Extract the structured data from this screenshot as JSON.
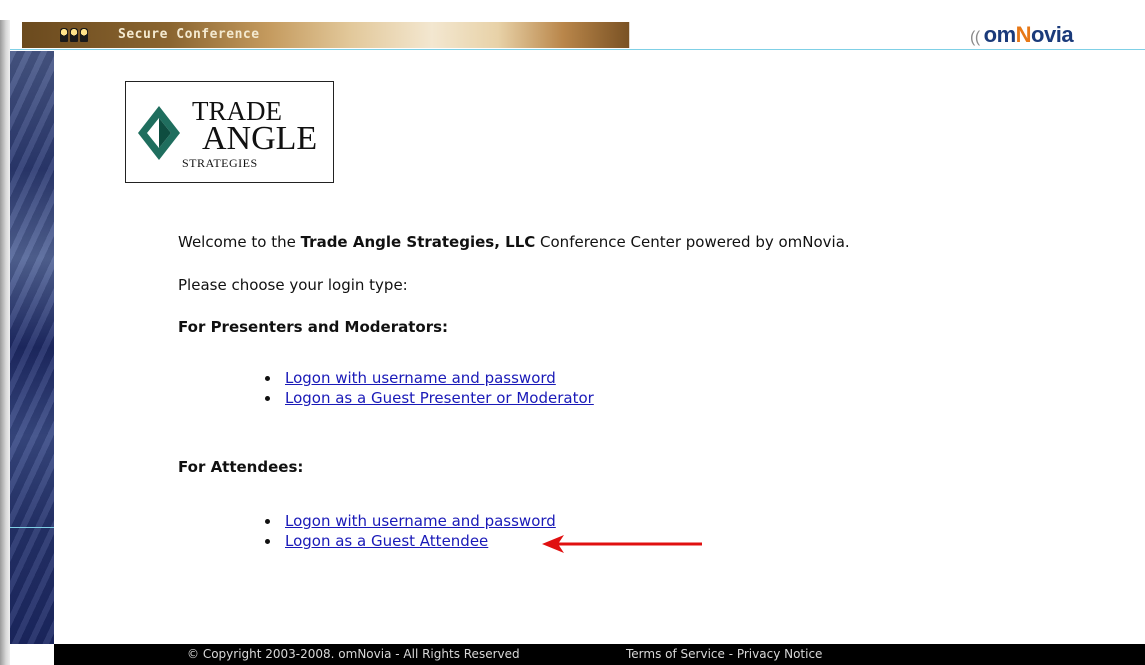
{
  "header": {
    "title": "Secure Conference",
    "brand": "omNovia",
    "brand_prefix": "om",
    "brand_n": "N",
    "brand_suffix": "ovia"
  },
  "logo": {
    "line1": "TRADE",
    "line2": "ANGLE",
    "line3": "STRATEGIES"
  },
  "welcome": {
    "prefix": "Welcome to the ",
    "company": "Trade Angle Strategies, LLC",
    "suffix": " Conference Center powered by omNovia."
  },
  "choose_text": "Please choose your login type:",
  "presenters": {
    "heading": "For Presenters and Moderators:",
    "links": [
      "Logon with username and password",
      "Logon as a Guest Presenter or Moderator"
    ]
  },
  "attendees": {
    "heading": "For Attendees:",
    "links": [
      "Logon with username and password",
      "Logon as a Guest Attendee"
    ]
  },
  "footer": {
    "copyright": "© Copyright 2003-2008. omNovia - All Rights Reserved",
    "terms": "Terms of Service - Privacy Notice"
  },
  "colors": {
    "link": "#1a1ab8",
    "arrow": "#e01010",
    "accent_line": "#7fd0e6",
    "brand_blue": "#1a3a7a",
    "brand_orange": "#e77817"
  },
  "icons": {
    "conference": "people-group-icon",
    "arrow": "red-arrow-left-icon"
  }
}
